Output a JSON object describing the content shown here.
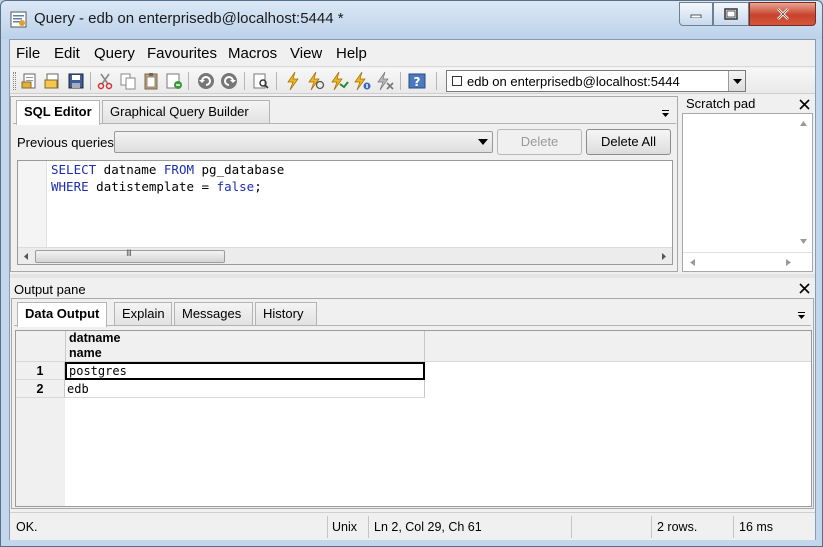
{
  "window": {
    "title": "Query - edb on enterprisedb@localhost:5444 *"
  },
  "menubar": {
    "items": [
      "File",
      "Edit",
      "Query",
      "Favourites",
      "Macros",
      "View",
      "Help"
    ]
  },
  "toolbar": {
    "icons": [
      "open-file-icon",
      "open-file-icon",
      "save-icon",
      "cut-icon",
      "copy-icon",
      "paste-icon",
      "clear-icon",
      "undo-icon",
      "redo-icon",
      "find-icon",
      "execute-icon",
      "execute-pgscript-icon",
      "execute-to-file-icon",
      "explain-icon",
      "explain-analyze-icon",
      "cancel-icon",
      "help-icon"
    ],
    "connection": "edb on enterprisedb@localhost:5444"
  },
  "editor": {
    "tabs": [
      "SQL Editor",
      "Graphical Query Builder"
    ],
    "previous_queries_label": "Previous queries",
    "delete_label": "Delete",
    "delete_all_label": "Delete All",
    "sql_lines": [
      {
        "kw1": "SELECT",
        "rest1": " datname ",
        "kw2": "FROM",
        "rest2": " pg_database"
      },
      {
        "kw1": "WHERE",
        "rest1": " datistemplate = ",
        "kw2": "false",
        "rest2": ";"
      }
    ],
    "scroll_thumb_label": "III"
  },
  "scratch_pad": {
    "title": "Scratch pad"
  },
  "output": {
    "title": "Output pane",
    "tabs": [
      "Data Output",
      "Explain",
      "Messages",
      "History"
    ],
    "column": {
      "name": "datname",
      "type": "name"
    },
    "rows": [
      {
        "num": "1",
        "value": "postgres"
      },
      {
        "num": "2",
        "value": "edb"
      }
    ]
  },
  "status": {
    "message": "OK.",
    "line_ending": "Unix",
    "position": "Ln 2, Col 29, Ch 61",
    "rows": "2 rows.",
    "time": "16 ms"
  }
}
